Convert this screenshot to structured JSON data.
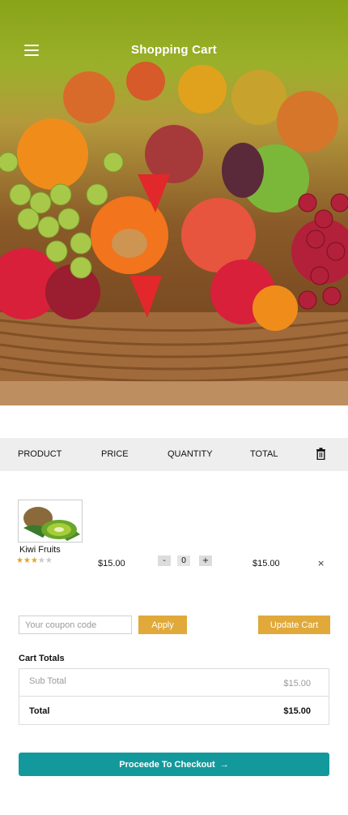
{
  "header": {
    "title": "Shopping Cart",
    "menu_icon": "hamburger-menu-icon"
  },
  "hero": {
    "image": "fruit-basket-image"
  },
  "table": {
    "headers": {
      "product": "PRODUCT",
      "price": "PRICE",
      "quantity": "QUANTITY",
      "total": "TOTAL",
      "remove_icon": "trash-icon"
    },
    "rows": [
      {
        "name": "Kiwi Fruits",
        "rating": 3,
        "rating_max": 5,
        "price": "$15.00",
        "quantity": "0",
        "minus": "-",
        "plus": "+",
        "total": "$15.00",
        "remove": "×"
      }
    ]
  },
  "coupon": {
    "placeholder": "Your coupon code",
    "apply_label": "Apply",
    "update_label": "Update Cart"
  },
  "totals": {
    "title": "Cart Totals",
    "sub_total_label": "Sub Total",
    "sub_total_value": "$15.00",
    "total_label": "Total",
    "total_value": "$15.00"
  },
  "checkout": {
    "label": "Proceede To Checkout",
    "arrow": "→"
  },
  "colors": {
    "accent": "#e0a93a",
    "checkout": "#13999c",
    "star_on": "#e0a52a",
    "star_off": "#c9c9c9"
  }
}
